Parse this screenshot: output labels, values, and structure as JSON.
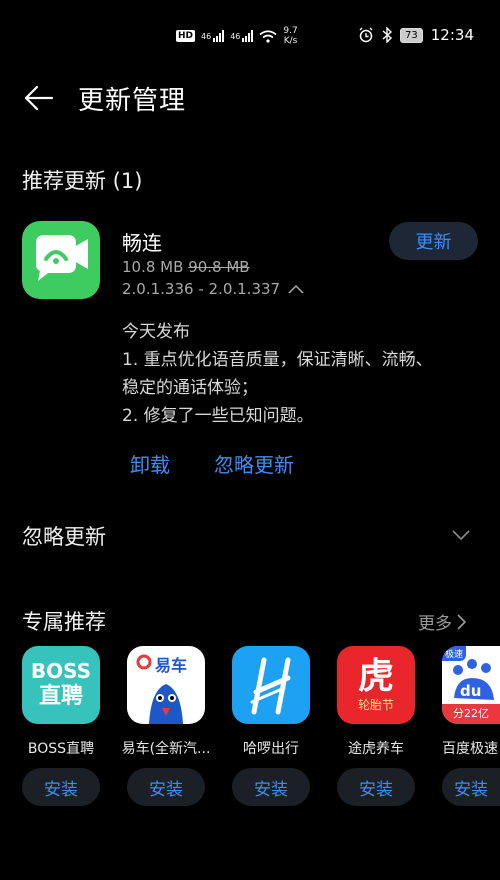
{
  "status_bar": {
    "hd_label": "HD",
    "sim1_label": "46",
    "sim2_label": "46",
    "speed_value": "9.7",
    "speed_unit": "K/s",
    "battery": "73",
    "time": "12:34"
  },
  "header": {
    "title": "更新管理"
  },
  "recommended_updates": {
    "heading": "推荐更新 (1)",
    "app": {
      "name": "畅连",
      "size_new": "10.8 MB",
      "size_old": "90.8 MB",
      "version": "2.0.1.336 - 2.0.1.337",
      "update_label": "更新",
      "release_notes": [
        "今天发布",
        "1. 重点优化语音质量，保证清晰、流畅、",
        "稳定的通话体验；",
        "2. 修复了一些已知问题。"
      ],
      "uninstall_label": "卸载",
      "ignore_label": "忽略更新"
    }
  },
  "ignored_updates": {
    "heading": "忽略更新"
  },
  "exclusive": {
    "heading": "专属推荐",
    "more_label": "更多",
    "apps": [
      {
        "name": "BOSS直聘",
        "icon_text_1": "BOSS",
        "icon_text_2": "直聘",
        "install_label": "安装"
      },
      {
        "name": "易车(全新汽...",
        "icon_text_1": "易车",
        "install_label": "安装"
      },
      {
        "name": "哈啰出行",
        "install_label": "安装"
      },
      {
        "name": "途虎养车",
        "icon_text_1": "虎",
        "icon_text_2": "轮胎节",
        "install_label": "安装"
      },
      {
        "name": "百度极速",
        "icon_text_1": "极速",
        "icon_text_2": "du",
        "icon_text_3": "分22亿",
        "install_label": "安装"
      }
    ]
  },
  "colors": {
    "accent": "#3f8cf5",
    "changlian_green": "#3ecb5f"
  }
}
